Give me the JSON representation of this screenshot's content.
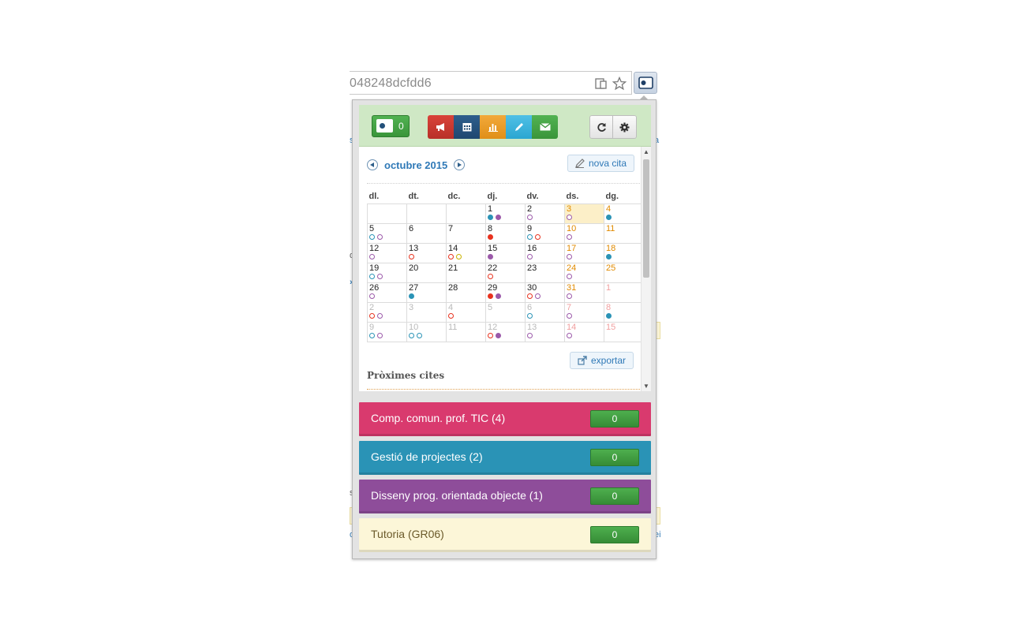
{
  "browser": {
    "url_fragment": "048248dcfdd6",
    "reader_icon": "reader-mode-icon",
    "star_icon": "star-icon",
    "extension_icon": "extension-icon"
  },
  "toolbar": {
    "counter_value": "0",
    "buttons": [
      "megaphone-icon",
      "calendar-icon",
      "chart-icon",
      "pencil-icon",
      "envelope-icon"
    ],
    "refresh_icon": "refresh-icon",
    "settings_icon": "gear-icon"
  },
  "calendar": {
    "month_label": "octubre 2015",
    "new_event_label": "nova cita",
    "export_label": "exportar",
    "upcoming_label": "Pròximes cites",
    "weekdays": [
      "dl.",
      "dt.",
      "dc.",
      "dj.",
      "dv.",
      "ds.",
      "dg."
    ],
    "weeks": [
      [
        {
          "d": ""
        },
        {
          "d": ""
        },
        {
          "d": ""
        },
        {
          "d": "1",
          "dots": [
            "fb",
            "fp"
          ]
        },
        {
          "d": "2",
          "dots": [
            "hp"
          ]
        },
        {
          "d": "3",
          "wk": true,
          "today": true,
          "dots": [
            "hp"
          ]
        },
        {
          "d": "4",
          "wk": true,
          "dots": [
            "fb"
          ]
        }
      ],
      [
        {
          "d": "5",
          "dots": [
            "hb",
            "hp"
          ]
        },
        {
          "d": "6"
        },
        {
          "d": "7"
        },
        {
          "d": "8",
          "dots": [
            "fr"
          ]
        },
        {
          "d": "9",
          "dots": [
            "hb",
            "hr"
          ]
        },
        {
          "d": "10",
          "wk": true,
          "dots": [
            "hp"
          ]
        },
        {
          "d": "11",
          "wk": true
        }
      ],
      [
        {
          "d": "12",
          "dots": [
            "hp"
          ]
        },
        {
          "d": "13",
          "dots": [
            "hr"
          ]
        },
        {
          "d": "14",
          "dots": [
            "hr",
            "hy"
          ]
        },
        {
          "d": "15",
          "dots": [
            "fp"
          ]
        },
        {
          "d": "16",
          "dots": [
            "hp"
          ]
        },
        {
          "d": "17",
          "wk": true,
          "dots": [
            "hp"
          ]
        },
        {
          "d": "18",
          "wk": true,
          "dots": [
            "fb"
          ]
        }
      ],
      [
        {
          "d": "19",
          "dots": [
            "hb",
            "hp"
          ]
        },
        {
          "d": "20"
        },
        {
          "d": "21"
        },
        {
          "d": "22",
          "dots": [
            "hr"
          ]
        },
        {
          "d": "23"
        },
        {
          "d": "24",
          "wk": true,
          "dots": [
            "hp"
          ]
        },
        {
          "d": "25",
          "wk": true
        }
      ],
      [
        {
          "d": "26",
          "dots": [
            "hp"
          ]
        },
        {
          "d": "27",
          "dots": [
            "fb"
          ]
        },
        {
          "d": "28"
        },
        {
          "d": "29",
          "dots": [
            "fr",
            "fp"
          ]
        },
        {
          "d": "30",
          "dots": [
            "hr",
            "hp"
          ]
        },
        {
          "d": "31",
          "wk": true,
          "dots": [
            "hp"
          ]
        },
        {
          "d": "1",
          "omwk": true
        }
      ],
      [
        {
          "d": "2",
          "om": true,
          "dots": [
            "hr",
            "hp"
          ]
        },
        {
          "d": "3",
          "om": true
        },
        {
          "d": "4",
          "om": true,
          "dots": [
            "hr"
          ]
        },
        {
          "d": "5",
          "om": true
        },
        {
          "d": "6",
          "om": true,
          "dots": [
            "hb"
          ]
        },
        {
          "d": "7",
          "omwk": true,
          "dots": [
            "hp"
          ]
        },
        {
          "d": "8",
          "omwk": true,
          "dots": [
            "fb"
          ]
        }
      ],
      [
        {
          "d": "9",
          "om": true,
          "dots": [
            "hb",
            "hp"
          ]
        },
        {
          "d": "10",
          "om": true,
          "dots": [
            "hb",
            "hb"
          ]
        },
        {
          "d": "11",
          "om": true
        },
        {
          "d": "12",
          "om": true,
          "dots": [
            "hr",
            "fp"
          ]
        },
        {
          "d": "13",
          "om": true,
          "dots": [
            "hp"
          ]
        },
        {
          "d": "14",
          "omwk": true,
          "dots": [
            "hp"
          ]
        },
        {
          "d": "15",
          "omwk": true
        }
      ]
    ]
  },
  "courses": [
    {
      "name": "Comp. comun. prof. TIC (4)",
      "count": "0",
      "bg": "#d93a6e",
      "fg": "#ffffff"
    },
    {
      "name": "Gestió de projectes (2)",
      "count": "0",
      "bg": "#2a93b6",
      "fg": "#ffffff"
    },
    {
      "name": "Disseny prog. orientada objecte (1)",
      "count": "0",
      "bg": "#8e4d9a",
      "fg": "#ffffff"
    },
    {
      "name": "Tutoria (GR06)",
      "count": "0",
      "bg": "#fcf6d8",
      "fg": "#6b5a2a"
    }
  ],
  "colors": {
    "dot_blue": "#2a93b6",
    "dot_purple": "#9b59a9",
    "dot_red": "#e8321e",
    "dot_yellow": "#c9b300"
  }
}
